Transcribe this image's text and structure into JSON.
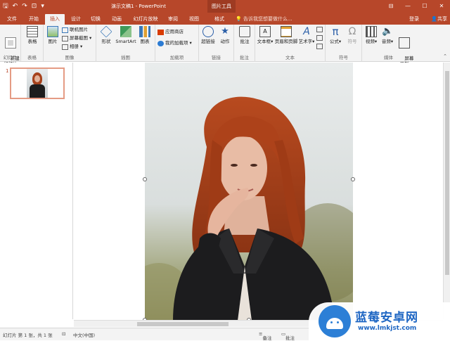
{
  "app": {
    "doc_title": "演示文稿1 - PowerPoint",
    "context_tab": "图片工具",
    "accent": "#b7472a"
  },
  "window_controls": {
    "restore_icon": "ribbon-display-icon",
    "min": "—",
    "max": "☐",
    "close": "✕"
  },
  "tabs": [
    {
      "label": "文件"
    },
    {
      "label": "开始"
    },
    {
      "label": "插入",
      "active": true
    },
    {
      "label": "设计"
    },
    {
      "label": "切换"
    },
    {
      "label": "动画"
    },
    {
      "label": "幻灯片放映"
    },
    {
      "label": "审阅"
    },
    {
      "label": "视图"
    },
    {
      "label": "格式"
    }
  ],
  "tell_me": {
    "placeholder": "告诉我您想要做什么..."
  },
  "account": {
    "login": "登录",
    "share": "共享"
  },
  "ribbon": {
    "slides": {
      "label": "幻灯片",
      "new_slide": "新建\n幻灯片"
    },
    "tables": {
      "label": "表格",
      "table": "表格"
    },
    "images": {
      "label": "图像",
      "picture": "图片",
      "online_picture": "联机图片",
      "screenshot": "屏幕截图",
      "album": "相册"
    },
    "illustrations": {
      "label": "插图",
      "shapes": "形状",
      "smartart": "SmartArt",
      "chart": "图表"
    },
    "addins": {
      "label": "加载项",
      "store": "应用商店",
      "my_addins": "我的加载项"
    },
    "links": {
      "label": "链接",
      "hyperlink": "超链接",
      "action": "动作"
    },
    "comments": {
      "label": "批注",
      "comment": "批注"
    },
    "text": {
      "label": "文本",
      "textbox": "文本框",
      "header_footer": "页眉和页脚",
      "wordart": "艺术字"
    },
    "symbols": {
      "label": "符号",
      "equation": "公式",
      "symbol": "符号"
    },
    "media": {
      "label": "媒体",
      "video": "视频",
      "audio": "音频",
      "screen_recording": "屏幕\n录制"
    }
  },
  "slide_panel": {
    "number": "1"
  },
  "status": {
    "slide_info": "幻灯片 第 1 张，共 1 张",
    "language": "中文(中国)",
    "notes": "备注",
    "comments": "批注"
  },
  "watermark": {
    "cn": "蓝莓安卓网",
    "url": "www.lmkjst.com"
  }
}
